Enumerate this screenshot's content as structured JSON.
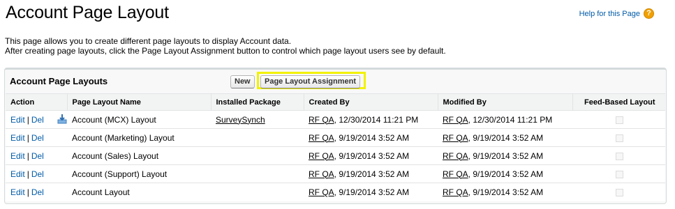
{
  "page": {
    "title": "Account Page Layout",
    "help_label": "Help for this Page",
    "help_icon": "question-icon",
    "description_lines": [
      "This page allows you to create different page layouts to display Account data.",
      "After creating page layouts, click the Page Layout Assignment button to control which page layout users see by default."
    ]
  },
  "panel": {
    "title": "Account Page Layouts",
    "new_button": "New",
    "assign_button": "Page Layout Assignment",
    "highlight_color": "#f2f200"
  },
  "table": {
    "headers": [
      "Action",
      "Page Layout Name",
      "Installed Package",
      "Created By",
      "Modified By",
      "Feed-Based Layout"
    ],
    "edit_label": "Edit",
    "del_label": "Del",
    "separator": "|",
    "rows": [
      {
        "name": "Account (MCX) Layout",
        "package": "SurveySynch",
        "installed_icon": "package-install-icon",
        "created_user": "RF QA",
        "created_date": ", 12/30/2014 11:21 PM",
        "modified_user": "RF QA",
        "modified_date": ", 12/30/2014 11:21 PM",
        "feed_based": false
      },
      {
        "name": "Account (Marketing) Layout",
        "package": "",
        "created_user": "RF QA",
        "created_date": ", 9/19/2014 3:52 AM",
        "modified_user": "RF QA",
        "modified_date": ", 9/19/2014 3:52 AM",
        "feed_based": false
      },
      {
        "name": "Account (Sales) Layout",
        "package": "",
        "created_user": "RF QA",
        "created_date": ", 9/19/2014 3:52 AM",
        "modified_user": "RF QA",
        "modified_date": ", 9/19/2014 3:52 AM",
        "feed_based": false
      },
      {
        "name": "Account (Support) Layout",
        "package": "",
        "created_user": "RF QA",
        "created_date": ", 9/19/2014 3:52 AM",
        "modified_user": "RF QA",
        "modified_date": ", 9/19/2014 3:52 AM",
        "feed_based": false
      },
      {
        "name": "Account Layout",
        "package": "",
        "created_user": "RF QA",
        "created_date": ", 9/19/2014 3:52 AM",
        "modified_user": "RF QA",
        "modified_date": ", 9/19/2014 3:52 AM",
        "feed_based": false
      }
    ]
  }
}
